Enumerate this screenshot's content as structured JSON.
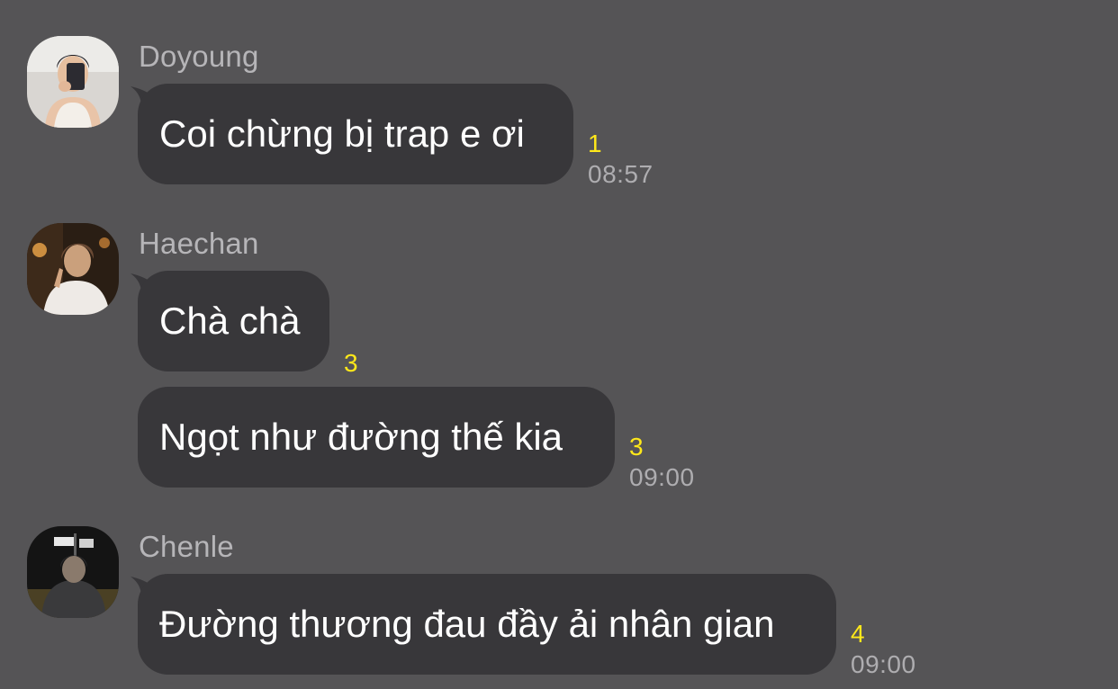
{
  "messages": [
    {
      "sender": "Doyoung",
      "avatar_icon": "profile-photo-doyoung",
      "bubbles": [
        {
          "text": "Coi chừng bị trap e ơi",
          "unread": "1",
          "time": "08:57"
        }
      ]
    },
    {
      "sender": "Haechan",
      "avatar_icon": "profile-photo-haechan",
      "bubbles": [
        {
          "text": "Chà chà",
          "unread": "3",
          "time": ""
        },
        {
          "text": "Ngọt như đường thế kia",
          "unread": "3",
          "time": "09:00"
        }
      ]
    },
    {
      "sender": "Chenle",
      "avatar_icon": "profile-photo-chenle",
      "bubbles": [
        {
          "text": "Đường thương đau đầy ải nhân gian",
          "unread": "4",
          "time": "09:00"
        }
      ]
    }
  ],
  "colors": {
    "background": "#555456",
    "bubble": "#38373a",
    "unread": "#ffe81a",
    "meta_text": "#aeadb0"
  }
}
